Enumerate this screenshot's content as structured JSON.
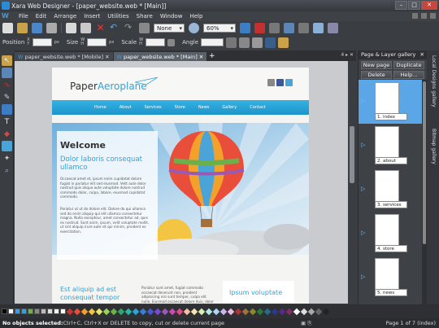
{
  "window": {
    "title": "Xara Web Designer - [paper_website.web * [Main]]",
    "buttons": [
      "–",
      "□",
      "✕"
    ]
  },
  "menu": {
    "items": [
      "File",
      "Edit",
      "Arrange",
      "Insert",
      "Utilities",
      "Share",
      "Window",
      "Help"
    ]
  },
  "toolbar": {
    "quality_value": "None",
    "zoom_value": "60%"
  },
  "infobar": {
    "position_label": "Position",
    "x_label": "X",
    "y_label": "Y",
    "size_label": "Size",
    "w_label": "W",
    "h_label": "H",
    "scale_label": "Scale",
    "scale_w": "W",
    "scale_h": "H",
    "angle_label": "Angle",
    "units": "px"
  },
  "tools": {
    "items": [
      "selector-icon",
      "contour-icon",
      "freehand-icon",
      "pen-icon",
      "rectangle-icon",
      "text-icon",
      "fill-icon",
      "transparency-icon",
      "shadow-icon",
      "zoom-icon"
    ],
    "text_glyph": "T"
  },
  "tabs": {
    "items": [
      {
        "label": "paper_website.web * [Mobile]"
      },
      {
        "label": "paper_website.web * [Main]"
      }
    ],
    "add": "+",
    "controls": "4 ▸ ✕"
  },
  "site": {
    "logo_part1": "Paper",
    "logo_part2": "Aeroplane",
    "nav": [
      "Home",
      "About",
      "Services",
      "Store",
      "News",
      "Gallery",
      "Contact"
    ],
    "welcome": "Welcome",
    "subhead": "Dolor laboris consequat ullamco",
    "para1": "Occaecat amet et, ipsum enim cupidatat dolore fugiat in pariatur elit sed eiusmod. Velit aute dolor nostrud quis aliqua aute voluptate dolore nostrud commodo dolor, culpa, labore, eiusmod cupidatat commodo.",
    "para2": "Pariatur ut ut do dolore elit. Dolore do qui ullamco sed do enim aliquip qui elit ullamco consectetur magna. Nulla excepteur, amet consectetur ad, quis ex nostrud. Sunt anim, ipsum, velit voluptate mollit, ut sint aliquip irure aute sit qui minim, proident ex exercitation.",
    "lower_title": "Est aliquip ad est consequat tempor",
    "lower_text": "Pariatur sunt amet, fugiat commodo occaecat deserunt non, proident adipisicing nisi sunt tempor, culpa elit nulla. Eiusmod occaecat dolore duis, dolor sit ut fugiat.",
    "box_title": "Ipsum voluptate"
  },
  "gallery": {
    "title": "Page & Layer gallery",
    "close": "✕",
    "buttons": [
      "New page",
      "Duplicate",
      "Delete",
      "Help..."
    ],
    "pages": [
      "1. index",
      "2. about",
      "3. services",
      "4. store",
      "5. news"
    ]
  },
  "side_tabs": [
    "Local Designs gallery",
    "Bitmap gallery"
  ],
  "status": {
    "bold": "No objects selected:",
    "text": " Ctrl+C, Ctrl+X or DELETE to copy, cut or delete current page",
    "page": "Page 1 of 7 (index)"
  },
  "colors": {
    "accent": "#2ba5dc",
    "selected_page": "#5aa6e6",
    "nav_bar": "#1e94c9"
  }
}
